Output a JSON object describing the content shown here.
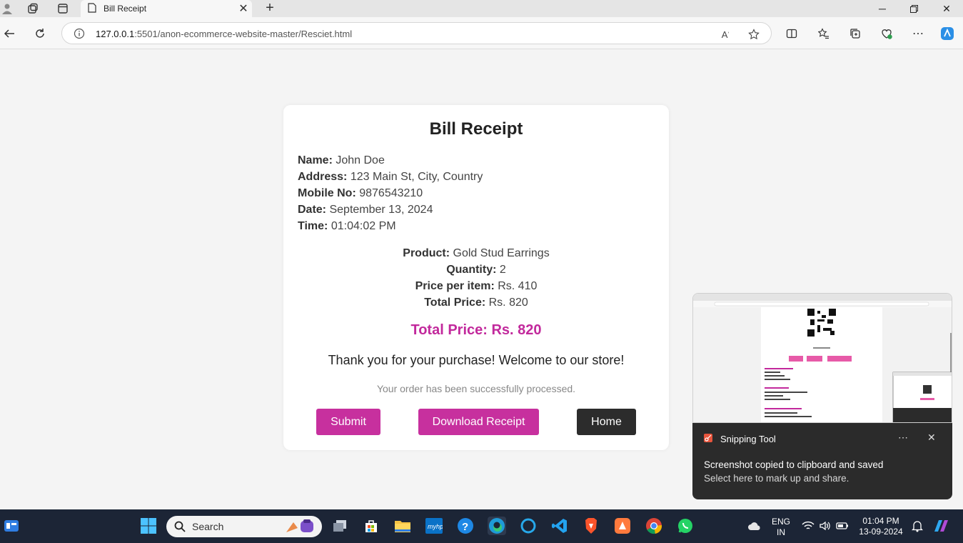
{
  "browser": {
    "tab_title": "Bill Receipt",
    "url_host": "127.0.0.1",
    "url_path": ":5501/anon-ecommerce-website-master/Resciet.html"
  },
  "receipt": {
    "title": "Bill Receipt",
    "customer": [
      {
        "label": "Name:",
        "value": "John Doe"
      },
      {
        "label": "Address:",
        "value": "123 Main St, City, Country"
      },
      {
        "label": "Mobile No:",
        "value": "9876543210"
      },
      {
        "label": "Date:",
        "value": "September 13, 2024"
      },
      {
        "label": "Time:",
        "value": "01:04:02 PM"
      }
    ],
    "product": [
      {
        "label": "Product:",
        "value": "Gold Stud Earrings"
      },
      {
        "label": "Quantity:",
        "value": "2"
      },
      {
        "label": "Price per item:",
        "value": "Rs. 410"
      },
      {
        "label": "Total Price:",
        "value": "Rs. 820"
      }
    ],
    "grand_total": "Total Price: Rs. 820",
    "thanks": "Thank you for your purchase! Welcome to our store!",
    "status": "Your order has been successfully processed.",
    "buttons": {
      "submit": "Submit",
      "download": "Download Receipt",
      "home": "Home"
    }
  },
  "toast": {
    "app": "Snipping Tool",
    "title": "Screenshot copied to clipboard and saved",
    "body": "Select here to mark up and share."
  },
  "taskbar": {
    "search_placeholder": "Search",
    "lang_top": "ENG",
    "lang_bottom": "IN",
    "time": "01:04 PM",
    "date": "13-09-2024"
  },
  "colors": {
    "accent": "#c7309e",
    "dark_button": "#2c2c2c",
    "taskbar": "#1c2536"
  }
}
